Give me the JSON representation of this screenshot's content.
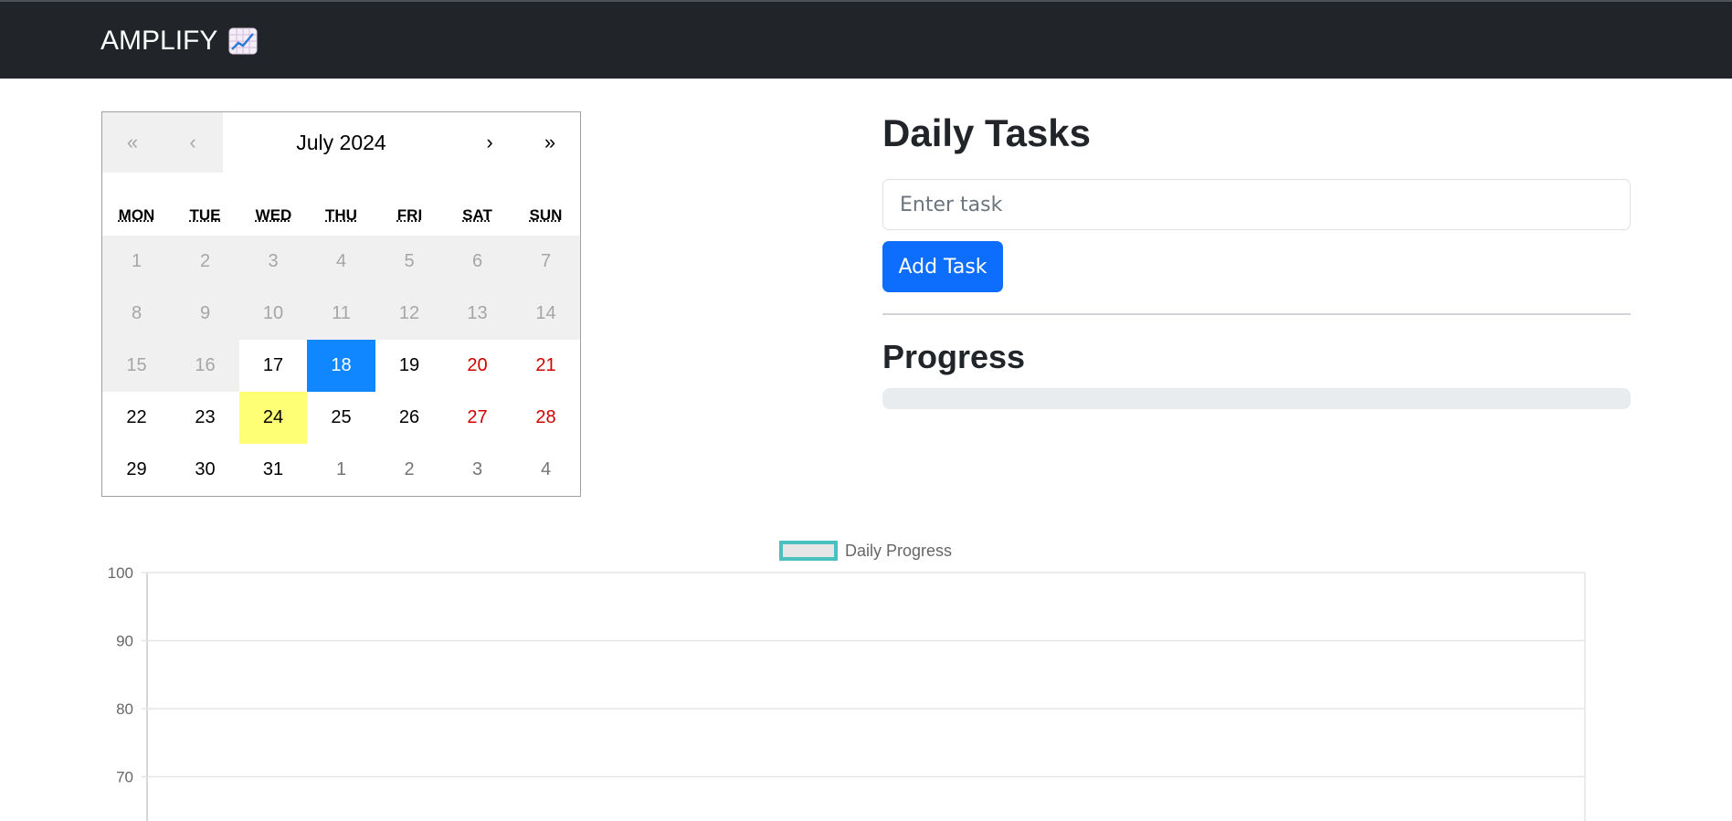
{
  "navbar": {
    "brand": "AMPLIFY",
    "brand_icon": "chart-increasing-icon"
  },
  "calendar": {
    "label": "July 2024",
    "nav": {
      "prev2": "«",
      "prev": "‹",
      "next": "›",
      "next2": "»"
    },
    "weekdays": [
      "MON",
      "TUE",
      "WED",
      "THU",
      "FRI",
      "SAT",
      "SUN"
    ],
    "weeks": [
      [
        "1",
        "2",
        "3",
        "4",
        "5",
        "6",
        "7"
      ],
      [
        "8",
        "9",
        "10",
        "11",
        "12",
        "13",
        "14"
      ],
      [
        "15",
        "16",
        "17",
        "18",
        "19",
        "20",
        "21"
      ],
      [
        "22",
        "23",
        "24",
        "25",
        "26",
        "27",
        "28"
      ],
      [
        "29",
        "30",
        "31",
        "1",
        "2",
        "3",
        "4"
      ]
    ],
    "selected_day": "18",
    "today": "24"
  },
  "tasks": {
    "title": "Daily Tasks",
    "input_placeholder": "Enter task",
    "input_value": "",
    "add_button": "Add Task"
  },
  "progress": {
    "title": "Progress",
    "value_percent": 0
  },
  "colors": {
    "navbar": "#212529",
    "accent": "#0d6efd",
    "selected": "#1087ff",
    "today": "#ffff76",
    "weekend": "#d10000",
    "series": "#4bc0c0"
  },
  "chart_data": {
    "type": "line",
    "series": [
      {
        "name": "Daily Progress",
        "values": []
      }
    ],
    "y_ticks": [
      "100",
      "90",
      "80",
      "70"
    ],
    "ylim": [
      0,
      100
    ],
    "grid": true,
    "legend": "top-center"
  }
}
